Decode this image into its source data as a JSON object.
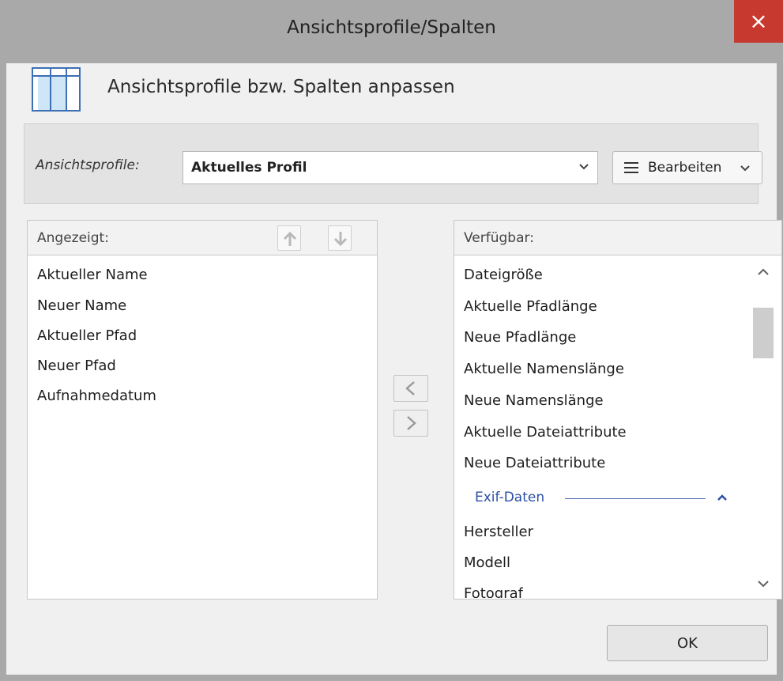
{
  "window": {
    "title": "Ansichtsprofile/Spalten",
    "close_glyph": "×"
  },
  "header": {
    "icon": "columns-icon",
    "text": "Ansichtsprofile bzw. Spalten anpassen"
  },
  "profile": {
    "label": "Ansichtsprofile:",
    "selected": "Aktuelles Profil",
    "edit_label": "Bearbeiten"
  },
  "displayed": {
    "header": "Angezeigt:",
    "items": [
      "Aktueller Name",
      "Neuer Name",
      "Aktueller Pfad",
      "Neuer Pfad",
      "Aufnahmedatum"
    ]
  },
  "available": {
    "header": "Verfügbar:",
    "items": [
      "Dateigröße",
      "Aktuelle Pfadlänge",
      "Neue Pfadlänge",
      "Aktuelle Namenslänge",
      "Neue Namenslänge",
      "Aktuelle Dateiattribute",
      "Neue Dateiattribute"
    ],
    "group_label": "Exif-Daten",
    "group_items": [
      "Hersteller",
      "Modell",
      "Fotograf"
    ]
  },
  "footer": {
    "ok_label": "OK"
  },
  "colors": {
    "close": "#c7392f",
    "group_accent": "#2b4fa6",
    "icon_fill": "#cfe6f7",
    "icon_stroke": "#3c6fb4"
  }
}
